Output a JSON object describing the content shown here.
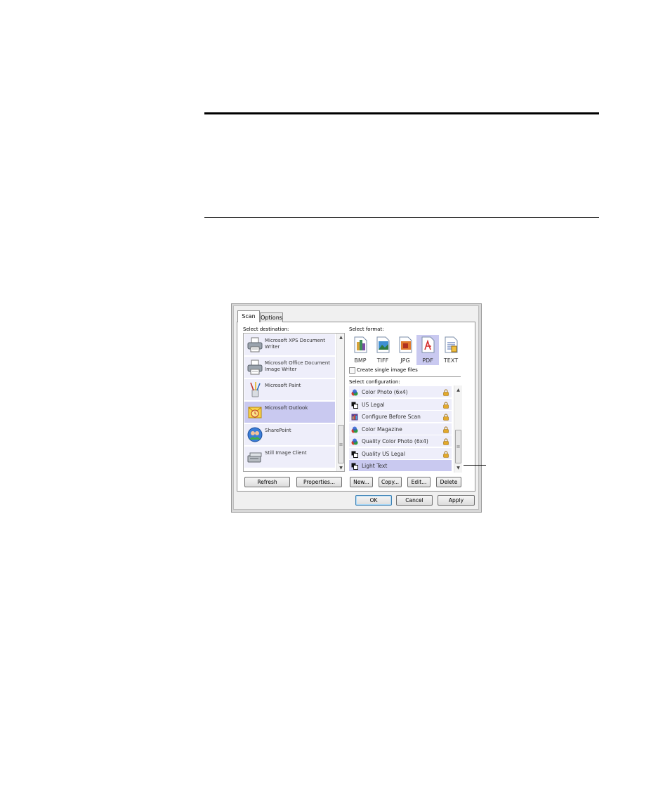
{
  "tabs": [
    {
      "label": "Scan"
    },
    {
      "label": "Options"
    }
  ],
  "destination": {
    "label": "Select destination:",
    "items": [
      {
        "label": "Microsoft XPS Document Writer",
        "icon": "printer-icon"
      },
      {
        "label": "Microsoft Office Document Image Writer",
        "icon": "printer-icon"
      },
      {
        "label": "Microsoft Paint",
        "icon": "paint-brush-icon"
      },
      {
        "label": "Microsoft Outlook",
        "icon": "outlook-icon",
        "selected": true
      },
      {
        "label": "SharePoint",
        "icon": "sharepoint-icon"
      },
      {
        "label": "Still Image Client",
        "icon": "scanner-icon"
      }
    ],
    "buttons": {
      "refresh": "Refresh",
      "properties": "Properties..."
    }
  },
  "format": {
    "label": "Select format:",
    "items": [
      {
        "label": "BMP",
        "icon": "bmp-icon"
      },
      {
        "label": "TIFF",
        "icon": "tiff-icon"
      },
      {
        "label": "JPG",
        "icon": "jpg-icon"
      },
      {
        "label": "PDF",
        "icon": "pdf-icon",
        "selected": true
      },
      {
        "label": "TEXT",
        "icon": "text-icon"
      }
    ],
    "single_image_label": "Create single image files",
    "single_image_checked": false
  },
  "configuration": {
    "label": "Select configuration:",
    "items": [
      {
        "label": "Color Photo (6x4)",
        "icon": "color-icon",
        "locked": true
      },
      {
        "label": "US Legal",
        "icon": "bw-icon",
        "locked": true
      },
      {
        "label": "Configure Before Scan",
        "icon": "configure-icon",
        "locked": true
      },
      {
        "label": "Color Magazine",
        "icon": "color-icon",
        "locked": true
      },
      {
        "label": "Quality Color Photo (6x4)",
        "icon": "color-icon",
        "locked": true
      },
      {
        "label": "Quality US Legal",
        "icon": "bw-icon",
        "locked": true
      },
      {
        "label": "Light Text",
        "icon": "bw-icon",
        "locked": false,
        "selected": true
      }
    ],
    "buttons": {
      "new": "New...",
      "copy": "Copy...",
      "edit": "Edit...",
      "delete": "Delete"
    }
  },
  "dialog_buttons": {
    "ok": "OK",
    "cancel": "Cancel",
    "apply": "Apply"
  },
  "colors": {
    "selection": "#c9c9f0",
    "item_bg": "#eeeefa",
    "lock": "#e3a92b",
    "default_button_border": "#3c7fb1"
  }
}
